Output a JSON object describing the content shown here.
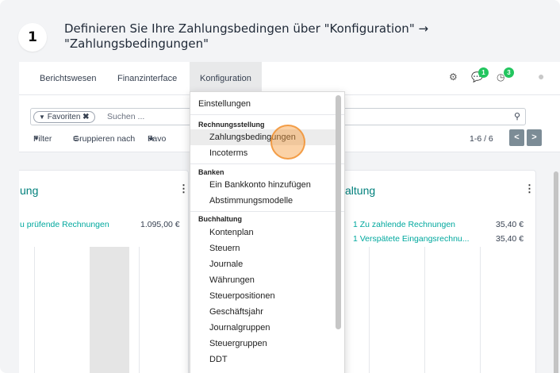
{
  "guide": {
    "step_number": "1",
    "instruction": "Definieren Sie Ihre Zahlungsbedingen über \"Konfiguration\" → \"Zahlungsbedingungen\""
  },
  "topnav": {
    "items": [
      "Berichtswesen",
      "Finanzinterface",
      "Konfiguration"
    ],
    "active": "Konfiguration",
    "badges": {
      "messages": "1",
      "activities": "3"
    }
  },
  "search": {
    "facet_label": "Favoriten",
    "placeholder": "Suchen ..."
  },
  "filterbar": {
    "filter": "Filter",
    "group_by": "Gruppieren nach",
    "favorites": "Favo"
  },
  "pager": {
    "text": "1-6 / 6",
    "prev": "<",
    "next": ">"
  },
  "cards": [
    {
      "title": "ung",
      "rows": [
        {
          "label": "u prüfende Rechnungen",
          "amount": "1.095,00 €"
        }
      ]
    },
    {
      "title": "altung",
      "rows": [
        {
          "label": "1 Zu zahlende Rechnungen",
          "amount": "35,40 €"
        },
        {
          "label": "1 Verspätete Eingangsrechnu...",
          "amount": "35,40 €"
        }
      ]
    }
  ],
  "dropdown": {
    "einstellungen": "Einstellungen",
    "rechnungsstellung": {
      "header": "Rechnungsstellung",
      "items": [
        "Zahlungsbedingungen",
        "Incoterms"
      ],
      "highlighted": "Zahlungsbedingungen"
    },
    "banken": {
      "header": "Banken",
      "items": [
        "Ein Bankkonto hinzufügen",
        "Abstimmungsmodelle"
      ]
    },
    "buchhaltung": {
      "header": "Buchhaltung",
      "items": [
        "Kontenplan",
        "Steuern",
        "Journale",
        "Währungen",
        "Steuerpositionen",
        "Geschäftsjahr",
        "Journalgruppen",
        "Steuergruppen",
        "DDT"
      ]
    }
  },
  "colors": {
    "accent_teal": "#00807c",
    "link_teal": "#00a89e",
    "badge_green": "#22c55e",
    "pager_button": "#7c8c96",
    "click_highlight": "#f69c3c"
  }
}
